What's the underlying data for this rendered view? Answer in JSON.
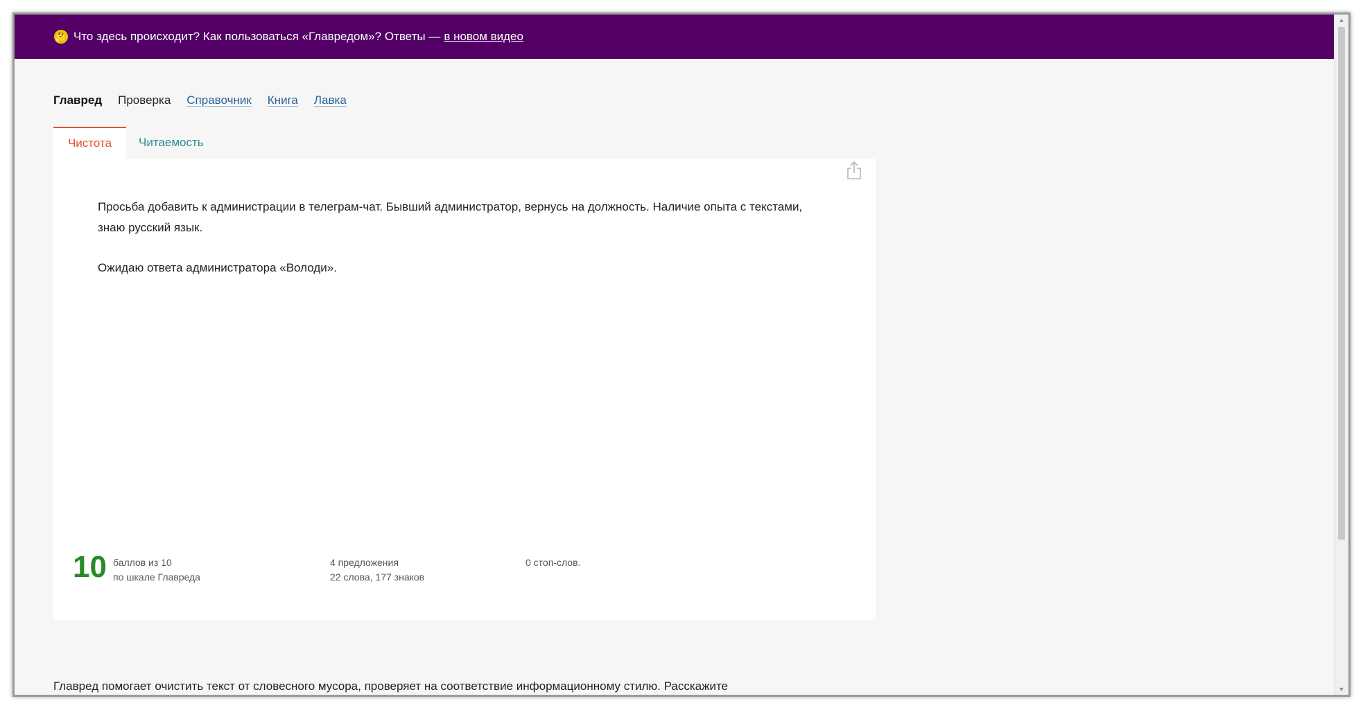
{
  "banner": {
    "emoji": "🤔",
    "text": "Что здесь происходит? Как пользоваться «Главредом»? Ответы —",
    "link": "в новом видео"
  },
  "nav": {
    "items": [
      {
        "label": "Главред",
        "state": "active"
      },
      {
        "label": "Проверка",
        "state": "plain"
      },
      {
        "label": "Справочник",
        "state": "link"
      },
      {
        "label": "Книга",
        "state": "link"
      },
      {
        "label": "Лавка",
        "state": "link"
      }
    ]
  },
  "tabs": [
    {
      "label": "Чистота",
      "active": true
    },
    {
      "label": "Читаемость",
      "active": false
    }
  ],
  "editor": {
    "paragraphs": [
      "Просьба добавить к администрации в телеграм-чат. Бывший администратор, вернусь на должность. Наличие опыта с текстами, знаю русский язык.",
      "Ожидаю ответа администратора «Володи»."
    ],
    "share_icon": "share-icon"
  },
  "stats": {
    "score": "10",
    "score_line1": "баллов из 10",
    "score_line2": "по шкале Главреда",
    "counts_line1": "4 предложения",
    "counts_line2": "22 слова, 177 знаков",
    "stop_words": "0 стоп-слов."
  },
  "footer": {
    "text": "Главред помогает очистить текст от словесного мусора, проверяет на соответствие информационному стилю. Расскажите"
  },
  "colors": {
    "banner_bg": "#520065",
    "accent_tab": "#e0522f",
    "score": "#2a8a2a",
    "link": "#2a6496"
  }
}
